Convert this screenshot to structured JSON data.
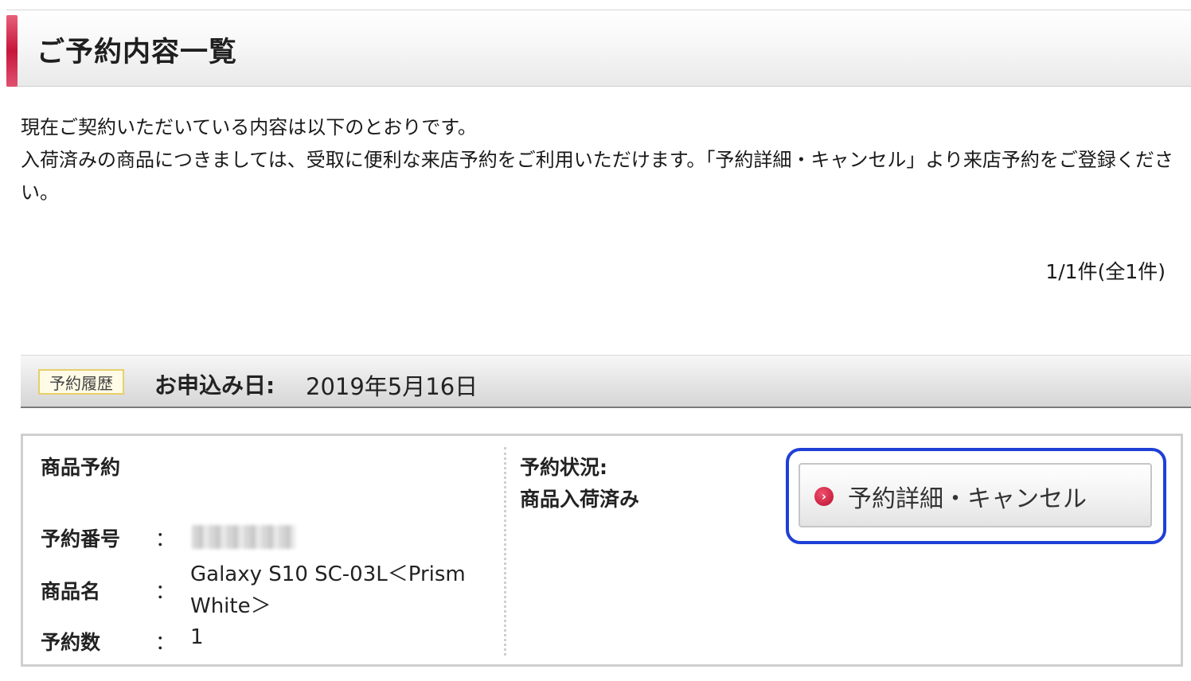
{
  "page": {
    "title": "ご予約内容一覧"
  },
  "intro": {
    "line1": "現在ご契約いただいている内容は以下のとおりです。",
    "line2": "入荷済みの商品につきましては、受取に便利な来店予約をご利用いただけます。「予約詳細・キャンセル」より来店予約をご登録ください。"
  },
  "pagination": {
    "count_text": "1/1件(全1件)"
  },
  "history": {
    "tag": "予約履歴",
    "date_label": "お申込み日:",
    "date_value": "2019年5月16日"
  },
  "reservation": {
    "section_title": "商品予約",
    "number_label": "予約番号",
    "product_label": "商品名",
    "product_value": "Galaxy S10 SC-03L＜Prism White＞",
    "quantity_label": "予約数",
    "quantity_value": "1",
    "colon": "：",
    "status_label": "予約状況:",
    "status_value": "商品入荷済み",
    "detail_button_label": "予約詳細・キャンセル",
    "detail_button_icon": "chevron-right-circle-icon"
  },
  "colors": {
    "accent": "#c7163a",
    "focus_ring": "#1f3fd6",
    "tag_border": "#e8cf6a"
  }
}
